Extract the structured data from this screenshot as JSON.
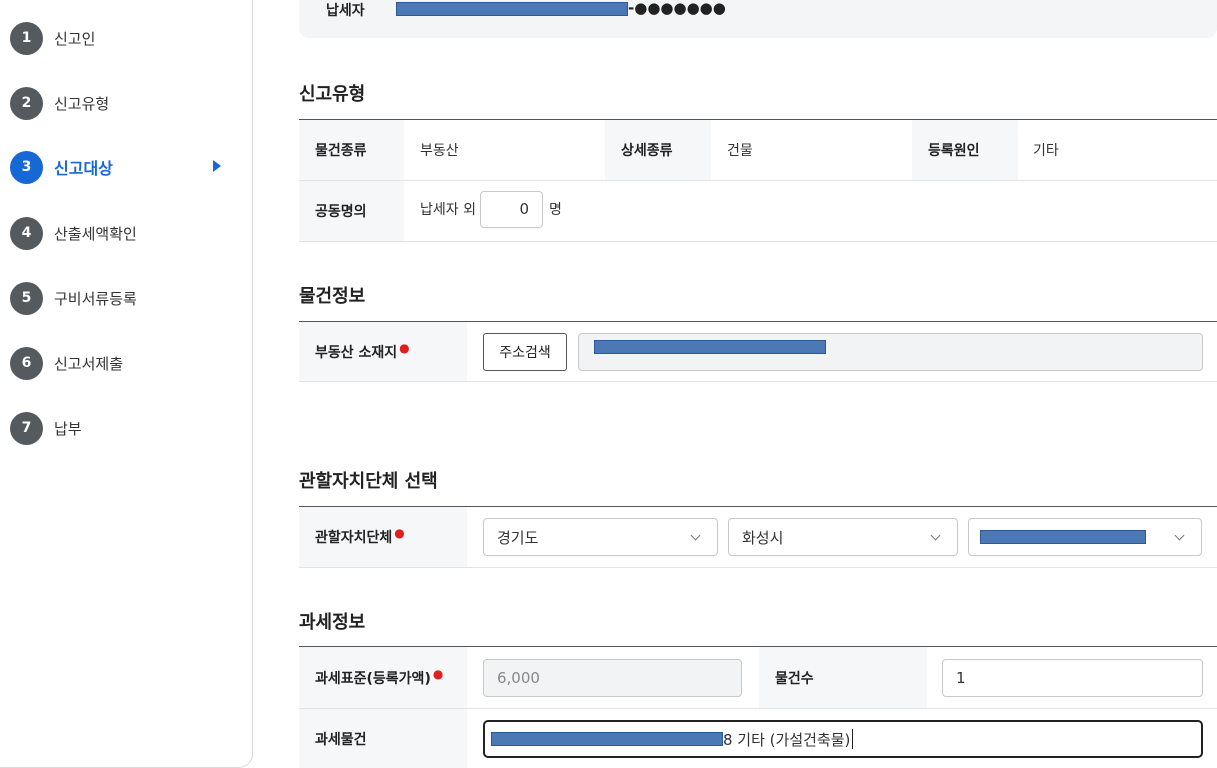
{
  "sidebar": {
    "steps": [
      {
        "num": "1",
        "label": "신고인"
      },
      {
        "num": "2",
        "label": "신고유형"
      },
      {
        "num": "3",
        "label": "신고대상"
      },
      {
        "num": "4",
        "label": "산출세액확인"
      },
      {
        "num": "5",
        "label": "구비서류등록"
      },
      {
        "num": "6",
        "label": "신고서제출"
      },
      {
        "num": "7",
        "label": "납부"
      }
    ],
    "active_step": "3"
  },
  "taxpayer": {
    "label": "납세자",
    "id_suffix": "-●●●●●●●"
  },
  "report_type": {
    "title": "신고유형",
    "item_kind_label": "물건종류",
    "item_kind_value": "부동산",
    "detail_kind_label": "상세종류",
    "detail_kind_value": "건물",
    "reg_cause_label": "등록원인",
    "reg_cause_value": "기타",
    "joint_label": "공동명의",
    "joint_prefix": "납세자 외",
    "joint_count": "0",
    "joint_suffix": "명"
  },
  "property_info": {
    "title": "물건정보",
    "location_label": "부동산 소재지",
    "address_search_button": "주소검색"
  },
  "jurisdiction": {
    "title": "관할자치단체 선택",
    "label": "관할자치단체",
    "province": "경기도",
    "city": "화성시"
  },
  "tax_info": {
    "title": "과세정보",
    "base_label": "과세표준(등록가액)",
    "base_value": "6,000",
    "count_label": "물건수",
    "count_value": "1",
    "object_label": "과세물건",
    "object_value_suffix": "8 기타 (가설건축물)"
  },
  "colors": {
    "accent": "#1668d4",
    "required": "#e02020",
    "redaction": "#4a79b5"
  }
}
